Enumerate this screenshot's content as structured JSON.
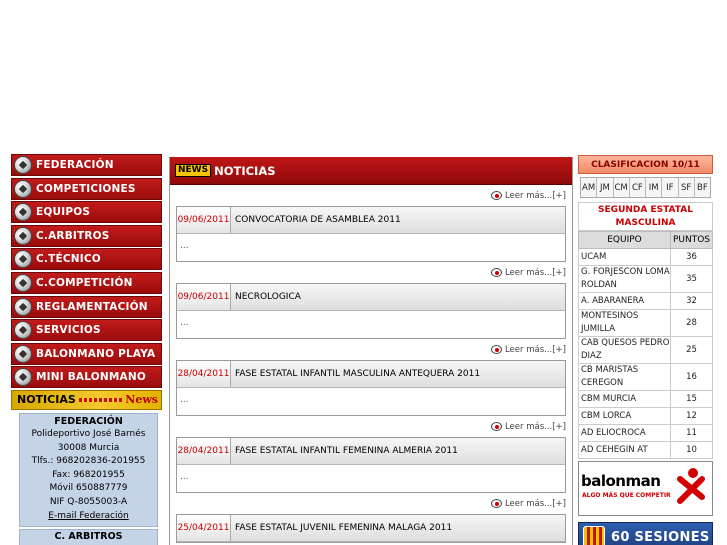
{
  "nav": {
    "items": [
      {
        "label": "FEDERACIÓN"
      },
      {
        "label": "COMPETICIONES"
      },
      {
        "label": "EQUIPOS"
      },
      {
        "label": "C.ARBITROS"
      },
      {
        "label": "C.TÉCNICO"
      },
      {
        "label": "C.COMPETICIÓN"
      },
      {
        "label": "REGLAMENTACIÓN"
      },
      {
        "label": "SERVICIOS"
      },
      {
        "label": "BALONMANO PLAYA"
      },
      {
        "label": "MINI BALONMANO"
      }
    ],
    "noticias_label": "NOTICIAS",
    "news_label": "News"
  },
  "federacion": {
    "title": "FEDERACIÓN",
    "lines": [
      "Polideportivo José Barnés",
      "30008 Murcia",
      "Tlfs.: 968202836-201955",
      "Fax: 968201955",
      "Móvil 650887779",
      "NIF Q-8055003-A"
    ],
    "email_link": "E-mail Federación",
    "next_title": "C. ARBITROS"
  },
  "center": {
    "badge": "NEWS",
    "title": "NOTICIAS",
    "read_more": "Leer más...[+]",
    "news": [
      {
        "date": "09/06/2011",
        "title": "CONVOCATORIA DE ASAMBLEA 2011",
        "excerpt": "..."
      },
      {
        "date": "09/06/2011",
        "title": "NECROLOGICA",
        "excerpt": "..."
      },
      {
        "date": "28/04/2011",
        "title": "FASE ESTATAL INFANTIL MASCULINA ANTEQUERA 2011",
        "excerpt": "..."
      },
      {
        "date": "28/04/2011",
        "title": "FASE ESTATAL INFANTIL FEMENINA ALMERIA 2011",
        "excerpt": "..."
      },
      {
        "date": "25/04/2011",
        "title": "FASE ESTATAL JUVENIL FEMENINA MALAGA 2011",
        "excerpt": ""
      }
    ]
  },
  "clasificacion": {
    "title": "CLASIFICACION 10/11",
    "categories": [
      "AM",
      "JM",
      "CM",
      "CF",
      "IM",
      "IF",
      "SF",
      "BF"
    ],
    "league_line1": "SEGUNDA ESTATAL",
    "league_line2": "MASCULINA",
    "col_team": "EQUIPO",
    "col_points": "PUNTOS",
    "rows": [
      {
        "team": "UCAM",
        "points": "36"
      },
      {
        "team": "G. FORJESCON LOMA ROLDAN",
        "points": "35"
      },
      {
        "team": "A. ABARANERA",
        "points": "32"
      },
      {
        "team": "MONTESINOS JUMILLA",
        "points": "28"
      },
      {
        "team": "CAB QUESOS PEDRO DIAZ",
        "points": "25"
      },
      {
        "team": "CB MARISTAS CEREGON",
        "points": "16"
      },
      {
        "team": "CBM MURCIA",
        "points": "15"
      },
      {
        "team": "CBM LORCA",
        "points": "12"
      },
      {
        "team": "AD ELIOCROCA",
        "points": "11"
      },
      {
        "team": "AD CEHEGIN AT",
        "points": "10"
      }
    ]
  },
  "ads": {
    "ad1_brand": "balonman",
    "ad1_tag": "ALGO MÁS QUE COMPETIR",
    "ad2_text": "60 SESIONES"
  }
}
